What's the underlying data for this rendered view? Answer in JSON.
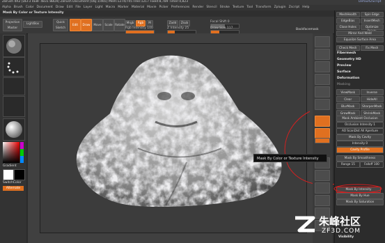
{
  "app": {
    "title": "ZBrush 4R2 [DEF3 4E8F 4831 8BD4]   ZBrush Document   [Obj:1/465] Mem:1274/745 Free:1217 Fixed:8,789 Timer:4,823",
    "window_right": "DefaultZScript"
  },
  "menu": [
    "Alpha",
    "Brush",
    "Color",
    "Document",
    "Draw",
    "Edit",
    "File",
    "Layer",
    "Light",
    "Macro",
    "Marker",
    "Material",
    "Movie",
    "Picker",
    "Preferences",
    "Render",
    "Stencil",
    "Stroke",
    "Texture",
    "Tool",
    "Transform",
    "Zplugin",
    "Zscript",
    "Help"
  ],
  "hint": "Mask By Color or Texture Intensity",
  "toolbar": {
    "projection_master": "Projection Master",
    "lightbox": "LightBox",
    "quick_sketch": "Quick Sketch",
    "edit": "Edit",
    "draw": "Draw",
    "move": "Move",
    "scale": "Scale",
    "rotate": "Rotate",
    "mrgb": "Mrgb",
    "rgb": "Rgb",
    "m": "M",
    "zadd": "Zadd",
    "zsub": "Zsub",
    "rgb_intensity": "Rgb Intensity 100",
    "z_intensity": "Z Intensity 25",
    "focal_shift": "Focal Shift 0",
    "draw_size": "Draw Size 117",
    "backface": "Backfacemask"
  },
  "left": {
    "gradient": "Gradient",
    "switchcolor": "SwitchColor",
    "alternate": "Alternate"
  },
  "tooltip": "Mask By Color or Texture Intensity",
  "right_panel": {
    "top_buttons": [
      "MeshHealth",
      "Spin Edge",
      "EdgeBias",
      "InsertMesh",
      "Close Holes",
      "Optimize Points",
      "Mirror And Weld",
      "Equalize Surface Area",
      "Check Mesh",
      "Fix Mesh"
    ],
    "sections": [
      "Fibermesh",
      "Geometry HD",
      "Preview",
      "Surface",
      "Deformation",
      "Masking"
    ],
    "masking_buttons": [
      "ViewMask",
      "Inverse",
      "Clear",
      "HideAll",
      "BlurMask",
      "SharpenMask",
      "GrowMask",
      "ShrinkMask"
    ],
    "ambient": "Mask Ambient Occlusion",
    "occlusion_intensity": "Occlusion Intensity 1",
    "scan_all": "AO ScanDist All Aperture",
    "mask_cavity": "Mask By Cavity",
    "cavity_intensity": "Intensity 0",
    "cavity_profile": "Cavity Profile",
    "mask_smoothness": "Mask By Smoothness",
    "range": "Range 15",
    "falloff": "Falloff 100",
    "mask_by_intensity": "Mask By Intensity",
    "mask_by_hue": "Mask By Hue",
    "mask_by_saturation": "Mask By Saturation",
    "visibility": "Visibility"
  },
  "watermark": {
    "cn": "朱峰社区",
    "url": "ZF3D.COM"
  },
  "colors": {
    "accent": "#e07020",
    "highlight_circle": "#d42020"
  }
}
